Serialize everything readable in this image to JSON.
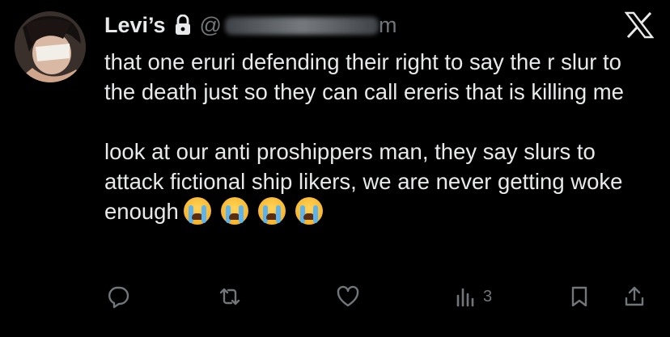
{
  "tweet": {
    "author_name": "Levi’s",
    "handle_visible": "@",
    "handle_suffix": "m",
    "text_paragraph_1": "that one eruri defending their right to say the r slur to the death just so they can call ereris that is killing me",
    "text_paragraph_2": "look at our anti proshippers man, they say slurs to attack fictional ship likers, we are never getting woke enough",
    "emojis": [
      "loudly-crying-face",
      "loudly-crying-face",
      "loudly-crying-face",
      "loudly-crying-face"
    ],
    "views_count": "3"
  },
  "icons": {
    "lock": "lock-icon",
    "platform_logo": "x-logo-icon",
    "reply": "reply-icon",
    "repost": "repost-icon",
    "like": "like-icon",
    "views": "views-icon",
    "bookmark": "bookmark-icon",
    "share": "share-icon"
  },
  "colors": {
    "background": "#000000",
    "text": "#e7e9ea",
    "muted": "#71767b"
  }
}
